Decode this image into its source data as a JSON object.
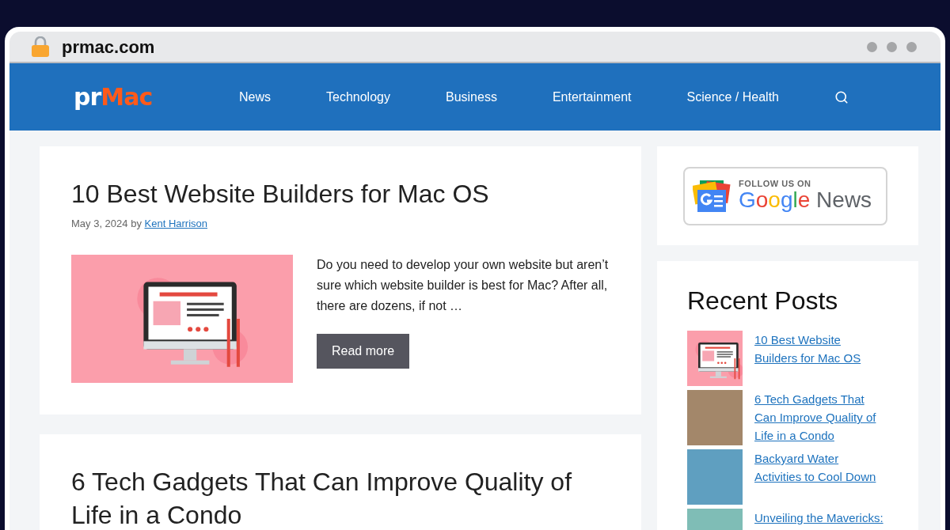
{
  "browser": {
    "url": "prmac.com"
  },
  "header": {
    "logo": {
      "prefix": "pr",
      "name": "Mac"
    },
    "nav": [
      {
        "label": "News"
      },
      {
        "label": "Technology"
      },
      {
        "label": "Business"
      },
      {
        "label": "Entertainment"
      },
      {
        "label": "Science / Health"
      }
    ]
  },
  "posts": [
    {
      "title": "10 Best Website Builders for Mac OS",
      "date": "May 3, 2024",
      "by": "by",
      "author": "Kent Harrison",
      "image": {
        "kind": "illustration"
      },
      "excerpt": "Do you need to develop your own website but aren’t sure which website builder is best for Mac? After all, there are dozens, if not …",
      "button": "Read more"
    },
    {
      "title": "6 Tech Gadgets That Can Improve Quality of Life in a Condo"
    }
  ],
  "sidebar": {
    "follow_badge": {
      "caption": "FOLLOW US ON",
      "brand": "Google",
      "service": "News"
    },
    "recent_posts": {
      "title": "Recent Posts",
      "items": [
        {
          "title": "10 Best Website Builders for Mac OS",
          "kind": "illustration"
        },
        {
          "title": "6 Tech Gadgets That Can Improve Quality of Life in a Condo",
          "kind": "photo"
        },
        {
          "title": "Backyard Water Activities to Cool Down",
          "kind": "photo"
        },
        {
          "title": "Unveiling the Mavericks:",
          "kind": "photo"
        }
      ]
    }
  }
}
